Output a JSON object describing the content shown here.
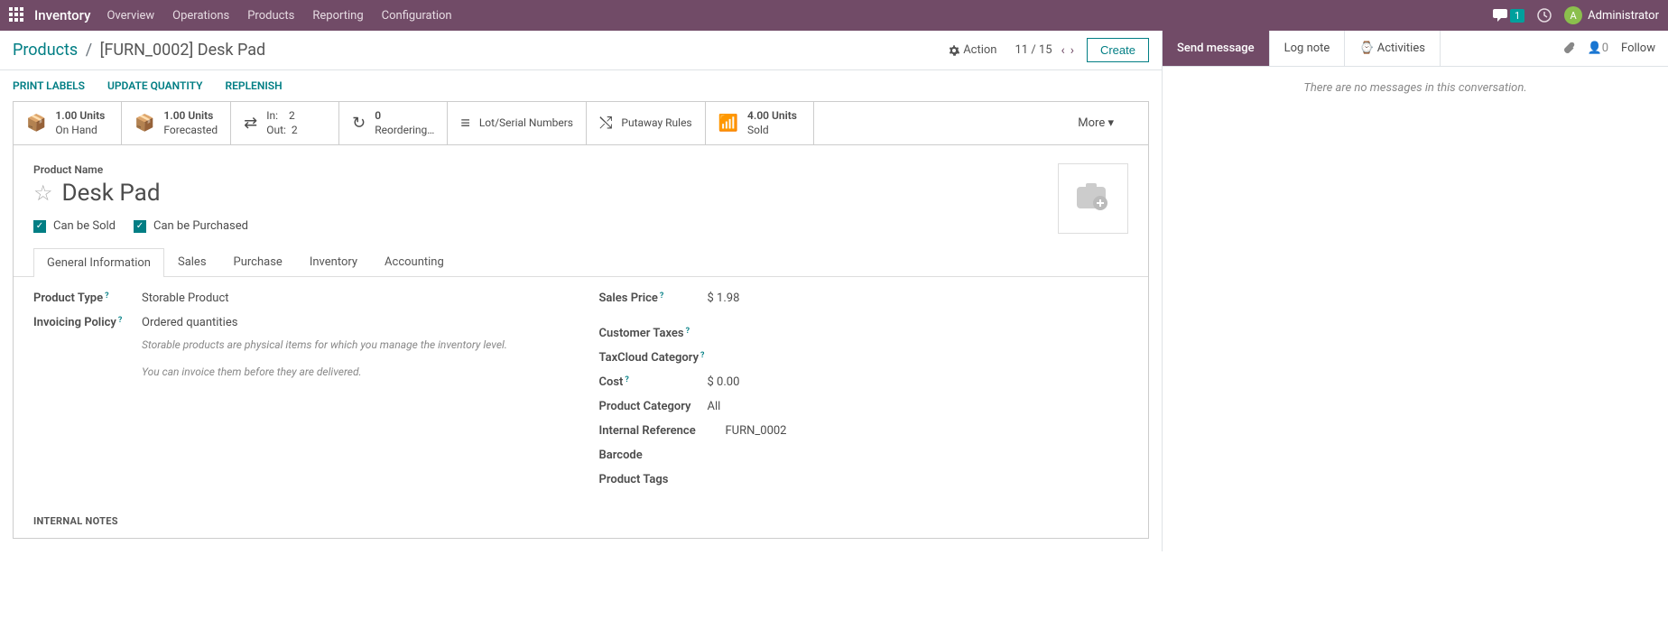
{
  "topbar": {
    "brand": "Inventory",
    "nav": [
      "Overview",
      "Operations",
      "Products",
      "Reporting",
      "Configuration"
    ],
    "msg_count": "1",
    "user": "Administrator",
    "avatar_initial": "A"
  },
  "breadcrumb": {
    "parent": "Products",
    "current": "[FURN_0002] Desk Pad"
  },
  "header": {
    "action": "Action",
    "pager": "11 / 15",
    "create": "Create"
  },
  "sub_actions": [
    "PRINT LABELS",
    "UPDATE QUANTITY",
    "REPLENISH"
  ],
  "stats": {
    "on_hand": {
      "value": "1.00 Units",
      "label": "On Hand"
    },
    "forecasted": {
      "value": "1.00 Units",
      "label": "Forecasted"
    },
    "in": "2",
    "out": "2",
    "reorder": {
      "value": "0",
      "label": "Reordering…"
    },
    "lot": "Lot/Serial Numbers",
    "putaway": "Putaway Rules",
    "sold": {
      "value": "4.00 Units",
      "label": "Sold"
    },
    "more": "More"
  },
  "product": {
    "name_label": "Product Name",
    "name": "Desk Pad",
    "can_sold": "Can be Sold",
    "can_purchased": "Can be Purchased"
  },
  "tabs": [
    "General Information",
    "Sales",
    "Purchase",
    "Inventory",
    "Accounting"
  ],
  "fields_left": {
    "product_type": {
      "label": "Product Type",
      "value": "Storable Product"
    },
    "invoicing": {
      "label": "Invoicing Policy",
      "value": "Ordered quantities"
    },
    "note1": "Storable products are physical items for which you manage the inventory level.",
    "note2": "You can invoice them before they are delivered."
  },
  "fields_right": {
    "sales_price": {
      "label": "Sales Price",
      "value": "$ 1.98"
    },
    "customer_taxes": {
      "label": "Customer Taxes",
      "value": ""
    },
    "taxcloud": {
      "label": "TaxCloud Category",
      "value": ""
    },
    "cost": {
      "label": "Cost",
      "value": "$ 0.00"
    },
    "category": {
      "label": "Product Category",
      "value": "All"
    },
    "internal_ref": {
      "label": "Internal Reference",
      "value": "FURN_0002"
    },
    "barcode": {
      "label": "Barcode",
      "value": ""
    },
    "tags": {
      "label": "Product Tags",
      "value": ""
    }
  },
  "internal_notes": "INTERNAL NOTES",
  "right": {
    "send": "Send message",
    "log": "Log note",
    "activities": "Activities",
    "followers": "0",
    "follow": "Follow",
    "empty": "There are no messages in this conversation."
  }
}
